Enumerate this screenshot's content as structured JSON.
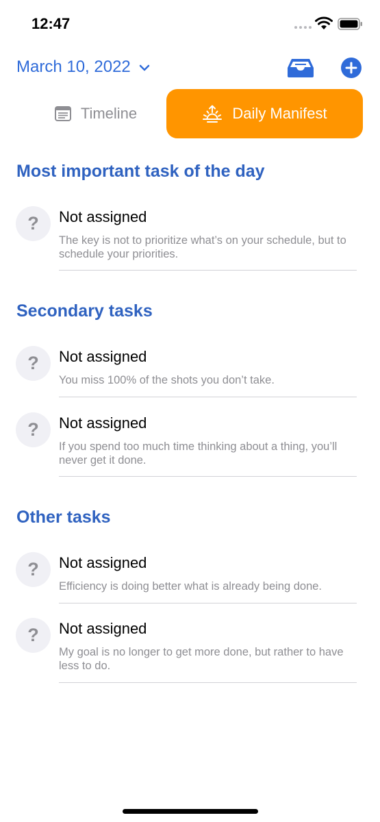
{
  "status_bar": {
    "time": "12:47"
  },
  "header": {
    "date_label": "March 10, 2022"
  },
  "tabs": [
    {
      "label": "Timeline",
      "icon": "list-icon",
      "selected": false
    },
    {
      "label": "Daily Manifest",
      "icon": "sunrise-icon",
      "selected": true
    }
  ],
  "sections": [
    {
      "title": "Most important task of the day",
      "tasks": [
        {
          "title": "Not assigned",
          "quote": "The key is not to prioritize what’s on your schedule, but to schedule your priorities."
        }
      ]
    },
    {
      "title": "Secondary tasks",
      "tasks": [
        {
          "title": "Not assigned",
          "quote": "You miss 100% of the shots you don’t take."
        },
        {
          "title": "Not assigned",
          "quote": "If you spend too much time thinking about a thing, you’ll never get it done."
        }
      ]
    },
    {
      "title": "Other tasks",
      "tasks": [
        {
          "title": "Not assigned",
          "quote": "Efficiency is doing better what is already being done."
        },
        {
          "title": "Not assigned",
          "quote": "My goal is no longer to get more done, but rather to have less to do."
        }
      ]
    }
  ],
  "placeholder_symbol": "?",
  "colors": {
    "accent_blue": "#2f6bd9",
    "section_title_blue": "#2f62c0",
    "selected_tab_orange": "#ff9500",
    "secondary_text_gray": "#8e8e93"
  }
}
